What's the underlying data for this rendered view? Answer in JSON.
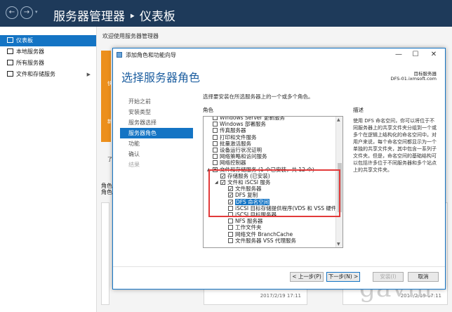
{
  "app": {
    "title": "服务器管理器 ‣ 仪表板"
  },
  "sidebar": {
    "items": [
      {
        "label": "仪表板",
        "icon": "dashboard-icon"
      },
      {
        "label": "本地服务器",
        "icon": "server-icon"
      },
      {
        "label": "所有服务器",
        "icon": "servers-icon"
      },
      {
        "label": "文件和存储服务",
        "icon": "storage-icon"
      }
    ]
  },
  "dashboard": {
    "welcome": "欢迎使用服务器管理器",
    "tile_labels": [
      "快",
      "新",
      "了"
    ],
    "roles_heading": "角色\n角色",
    "timestamps": [
      "2017/2/19 17:11",
      "2017/2/19 17:11"
    ]
  },
  "watermark": "gavin",
  "wizard": {
    "window_title": "添加角色和功能向导",
    "controls": {
      "minimize": "—",
      "maximize": "☐",
      "close": "✕"
    },
    "header": "选择服务器角色",
    "target_label": "目标服务器",
    "target_server": "DFS-01.ixmsoft.com",
    "steps": [
      {
        "label": "开始之前",
        "state": "normal"
      },
      {
        "label": "安装类型",
        "state": "normal"
      },
      {
        "label": "服务器选择",
        "state": "normal"
      },
      {
        "label": "服务器角色",
        "state": "active"
      },
      {
        "label": "功能",
        "state": "normal"
      },
      {
        "label": "确认",
        "state": "normal"
      },
      {
        "label": "结果",
        "state": "disabled"
      }
    ],
    "instruction": "选择要安装在所选服务器上的一个或多个角色。",
    "roles_col": "角色",
    "desc_col": "描述",
    "roles": [
      {
        "label": "Windows Server 更新服务",
        "indent": 0,
        "check": "none"
      },
      {
        "label": "Windows 部署服务",
        "indent": 0,
        "check": "none"
      },
      {
        "label": "传真服务器",
        "indent": 0,
        "check": "none"
      },
      {
        "label": "打印和文件服务",
        "indent": 0,
        "check": "none"
      },
      {
        "label": "批量激活服务",
        "indent": 0,
        "check": "none"
      },
      {
        "label": "设备运行状况证明",
        "indent": 0,
        "check": "none"
      },
      {
        "label": "网络策略和访问服务",
        "indent": 0,
        "check": "none"
      },
      {
        "label": "网络控制器",
        "indent": 0,
        "check": "none"
      },
      {
        "label": "文件和存储服务 (1 个已安装，共 12 个)",
        "indent": 0,
        "check": "partial",
        "expand": "▲"
      },
      {
        "label": "存储服务 (已安装)",
        "indent": 1,
        "check": "checked"
      },
      {
        "label": "文件和 iSCSI 服务",
        "indent": 1,
        "check": "checked",
        "expand": "◢"
      },
      {
        "label": "文件服务器",
        "indent": 2,
        "check": "checked"
      },
      {
        "label": "DFS 复制",
        "indent": 2,
        "check": "checked"
      },
      {
        "label": "DFS 命名空间",
        "indent": 2,
        "check": "checked",
        "selected": true
      },
      {
        "label": "iSCSI 目标存储提供程序(VDS 和 VSS 硬件",
        "indent": 2,
        "check": "none"
      },
      {
        "label": "iSCSI 目标服务器",
        "indent": 2,
        "check": "none"
      },
      {
        "label": "NFS 服务器",
        "indent": 2,
        "check": "none"
      },
      {
        "label": "工作文件夹",
        "indent": 2,
        "check": "none"
      },
      {
        "label": "网络文件 BranchCache",
        "indent": 2,
        "check": "none"
      },
      {
        "label": "文件服务器 VSS 代理服务",
        "indent": 2,
        "check": "none"
      }
    ],
    "description": "使用 DFS 命名空间，你可以将位于不同服务器上的共享文件夹分组到一个或多个在逻辑上结构化的命名空间中。对用户来说，每个命名空间都显示为一个单独的共享文件夹，其中包含一系列子文件夹。但是，命名空间的基础结构可以包括许多位于不同服务器和多个站点上的共享文件夹。",
    "buttons": {
      "prev": "< 上一步(P)",
      "next": "下一步(N) >",
      "install": "安装(I)",
      "cancel": "取消"
    }
  }
}
